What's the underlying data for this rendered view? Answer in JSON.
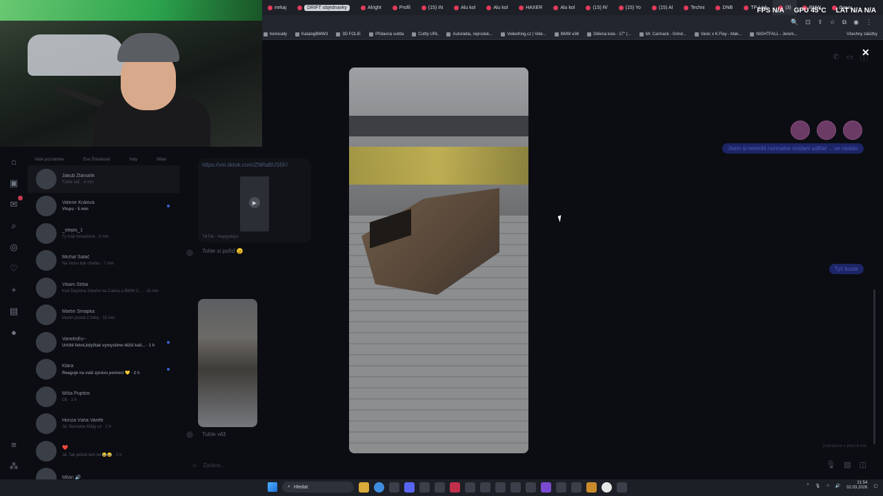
{
  "browser": {
    "tabs": [
      {
        "label": "mrkaj",
        "active": false
      },
      {
        "label": "DRIFT objednavky",
        "active": false,
        "pill": true
      },
      {
        "label": "Alright",
        "active": false
      },
      {
        "label": "Profil",
        "active": false
      },
      {
        "label": "(15) IN",
        "active": false
      },
      {
        "label": "Alu kol",
        "active": false
      },
      {
        "label": "Alu kol",
        "active": false
      },
      {
        "label": "HAXER",
        "active": false
      },
      {
        "label": "Alu kol",
        "active": false
      },
      {
        "label": "(15) R/",
        "active": false
      },
      {
        "label": "(15) Yo",
        "active": false
      },
      {
        "label": "(15) Al",
        "active": false
      },
      {
        "label": "Techni",
        "active": false
      },
      {
        "label": "DNB",
        "active": false
      },
      {
        "label": "TP-Link",
        "active": false
      },
      {
        "label": "(3)",
        "active": true
      },
      {
        "label": "BMW",
        "active": false
      },
      {
        "label": "dvouv",
        "active": false
      }
    ],
    "bookmarks": [
      "hemically",
      "KatalogBMW3",
      "3D FOLIE",
      "Přídavná světla",
      "Cuttly URL",
      "Autorádia, reproduk...",
      "VideoKing.cz | Vide...",
      "BMW e36",
      "Dělená kola - 17\" (...",
      "Mr. Carmack - Grind...",
      "Vanic x K.Flay - Mak...",
      "NIGHTFALL - Jerem..."
    ],
    "bookmarks_other": "Všechny záložky"
  },
  "overlay": {
    "fps_label": "FPS",
    "fps_value": "N/A",
    "gpu_label": "GPU",
    "gpu_value": "45°C",
    "lat_label": "LAT",
    "lat_value": "N/A",
    "lat_value2": "N/A"
  },
  "stories": [
    "Vaše poznámka",
    "Eva Šťastková",
    "Vaty",
    "Milan"
  ],
  "conversations": [
    {
      "name": "Jakub Zlámalík",
      "preview": "Tuhle věž · 4 min",
      "active": true
    },
    {
      "name": "Valerie Králová",
      "preview": "Vtopu · 5 min",
      "unread": true,
      "bold": true
    },
    {
      "name": "_stepis_1",
      "preview": "Ty tvoji hovadstva · 3 min"
    },
    {
      "name": "Michal Salač",
      "preview": "Na Volvo byk chvilku · 7 min"
    },
    {
      "name": "Viliam Štrba",
      "preview": "Kod Daytona 2dveřní na Cabou a BMW C... · 15 min"
    },
    {
      "name": "Martin Smapka",
      "preview": "Martin poslal 2 fotky · 15 min"
    },
    {
      "name": "VanellsEs~",
      "preview": "Určitě fekní,kdyžtak vymyslíme těžší kall... · 1 h",
      "unread": true,
      "bold": true
    },
    {
      "name": "Klára",
      "preview": "Reaguje na vaši zprávu pomocí 💛 · 2 h",
      "unread": true,
      "bold": true
    },
    {
      "name": "Míša Pupitos",
      "preview": "Ok · 2 h"
    },
    {
      "name": "Honza Váňa Vaněk",
      "preview": "Já: Nemame tišidy uz · 2 h"
    },
    {
      "name": "❤️",
      "preview": "Já: Tak jedině tam tel 😂😂 · 2 h"
    },
    {
      "name": "Milan 🔊",
      "preview": ""
    }
  ],
  "thread": {
    "link_url": "https://vm.tiktok.com/ZNRaBUS5F/",
    "link_source": "TikTok - Happydays",
    "msg_received_1": "Tohle si pořiď 😉",
    "msg_received_2": "Tuhle věž",
    "msg_sent_1": "Jsem si nemohl normalne snídani udělat ... se nedalo",
    "msg_sent_2": "Tyč buste",
    "seen_text": "Zobrazeno v před 4 min",
    "composer_placeholder": "Zpráva..."
  },
  "viewer": {
    "close_icon": "close-icon"
  },
  "taskbar": {
    "search_placeholder": "Hledat",
    "time": "21:54",
    "date": "02.03.2026"
  }
}
